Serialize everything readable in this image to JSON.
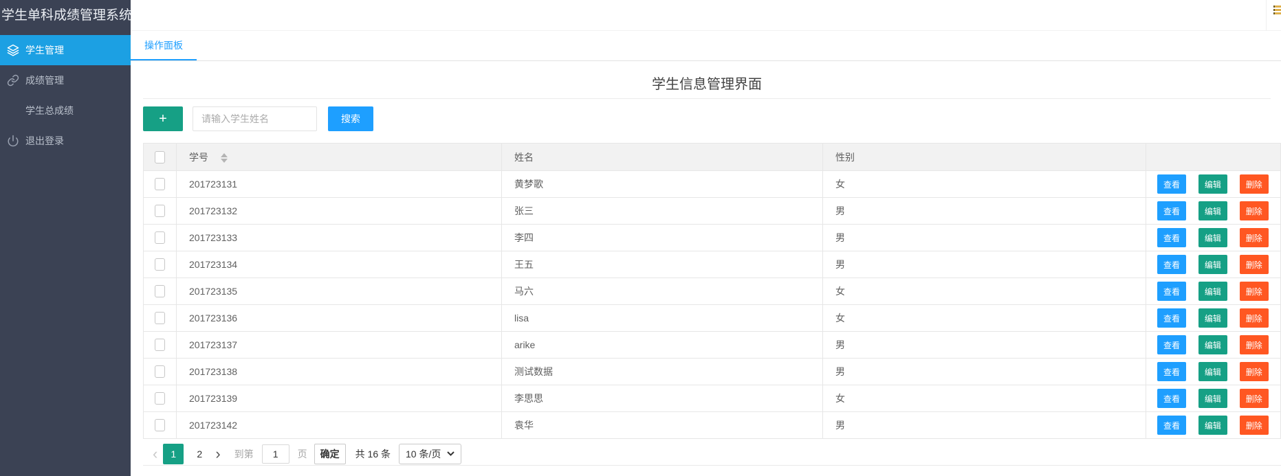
{
  "app": {
    "title": "学生单科成绩管理系统"
  },
  "sidebar": {
    "items": [
      {
        "label": "学生管理",
        "icon": "layers-icon",
        "active": true
      },
      {
        "label": "成绩管理",
        "icon": "link-icon",
        "active": false
      },
      {
        "label": "学生总成绩",
        "icon": "",
        "active": false
      },
      {
        "label": "退出登录",
        "icon": "power-icon",
        "active": false
      }
    ]
  },
  "tabs": {
    "items": [
      {
        "label": "操作面板",
        "active": true
      }
    ]
  },
  "main": {
    "title": "学生信息管理界面",
    "toolbar": {
      "add_button": "+",
      "search_placeholder": "请输入学生姓名",
      "search_button": "搜索"
    },
    "table": {
      "columns": [
        "学号",
        "姓名",
        "性别"
      ],
      "rows": [
        {
          "student_id": "201723131",
          "name": "黄梦歌",
          "gender": "女"
        },
        {
          "student_id": "201723132",
          "name": "张三",
          "gender": "男"
        },
        {
          "student_id": "201723133",
          "name": "李四",
          "gender": "男"
        },
        {
          "student_id": "201723134",
          "name": "王五",
          "gender": "男"
        },
        {
          "student_id": "201723135",
          "name": "马六",
          "gender": "女"
        },
        {
          "student_id": "201723136",
          "name": "lisa",
          "gender": "女"
        },
        {
          "student_id": "201723137",
          "name": "arike",
          "gender": "男"
        },
        {
          "student_id": "201723138",
          "name": "测试数据",
          "gender": "男"
        },
        {
          "student_id": "201723139",
          "name": "李思思",
          "gender": "女"
        },
        {
          "student_id": "201723142",
          "name": "袁华",
          "gender": "男"
        }
      ],
      "row_actions": [
        {
          "label": "查看",
          "color": "#1E9FFF"
        },
        {
          "label": "编辑",
          "color": "#16A085"
        },
        {
          "label": "删除",
          "color": "#FF5722"
        }
      ]
    },
    "pagination": {
      "prev": "‹",
      "next": "›",
      "pages": [
        "1",
        "2"
      ],
      "active_page": "1",
      "jump_prefix": "到第",
      "jump_value": "1",
      "jump_suffix": "页",
      "confirm_button": "确定",
      "total_text": "共 16 条",
      "page_size": "10 条/页"
    }
  },
  "colors": {
    "primary_blue": "#1E9FFF",
    "sidebar_active_blue": "#1CA0E3",
    "teal_green": "#16A085",
    "danger_orange": "#FF5722",
    "sidebar_bg": "#3B4254",
    "table_header_bg": "#F2F2F2",
    "border_gray": "#E6E6E6"
  }
}
